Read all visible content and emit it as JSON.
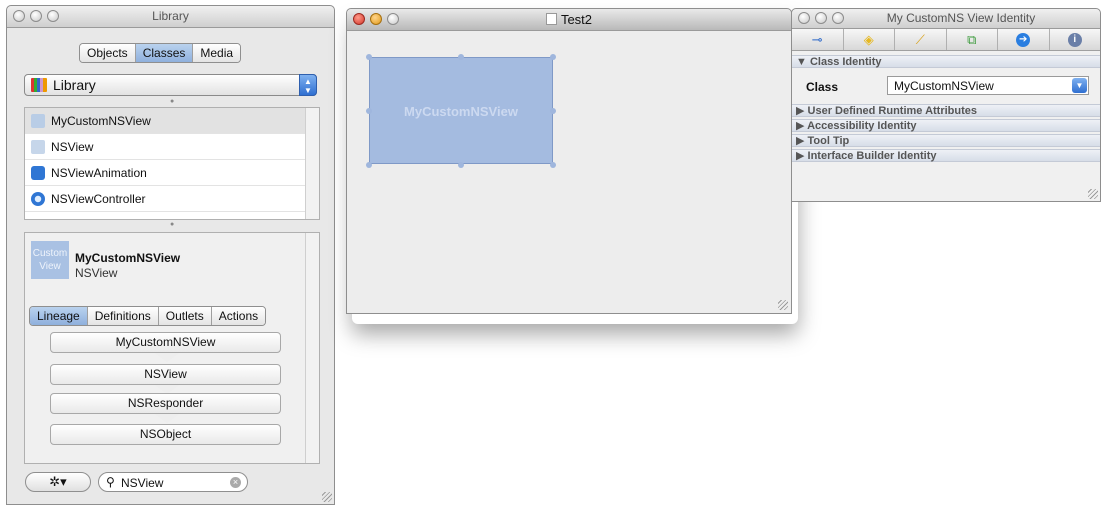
{
  "library": {
    "title": "Library",
    "tabs": [
      "Objects",
      "Classes",
      "Media"
    ],
    "selected_tab": "Classes",
    "popup_value": "Library",
    "classes": [
      "MyCustomNSView",
      "NSView",
      "NSViewAnimation",
      "NSViewController"
    ],
    "detail": {
      "thumb_label": "Custom View",
      "name": "MyCustomNSView",
      "superclass": "NSView"
    },
    "detail_tabs": [
      "Lineage",
      "Definitions",
      "Outlets",
      "Actions"
    ],
    "lineage": [
      "MyCustomNSView",
      "NSView",
      "NSResponder",
      "NSObject"
    ],
    "search_value": "NSView"
  },
  "canvas": {
    "title": "Test2",
    "view_label": "MyCustomNSView"
  },
  "inspector": {
    "title": "My CustomNS View Identity",
    "sections": {
      "class_identity": "Class Identity",
      "class_label": "Class",
      "class_value": "MyCustomNSView",
      "runtime_attrs": "User Defined Runtime Attributes",
      "accessibility": "Accessibility Identity",
      "tooltip": "Tool Tip",
      "ib_identity": "Interface Builder Identity"
    }
  }
}
